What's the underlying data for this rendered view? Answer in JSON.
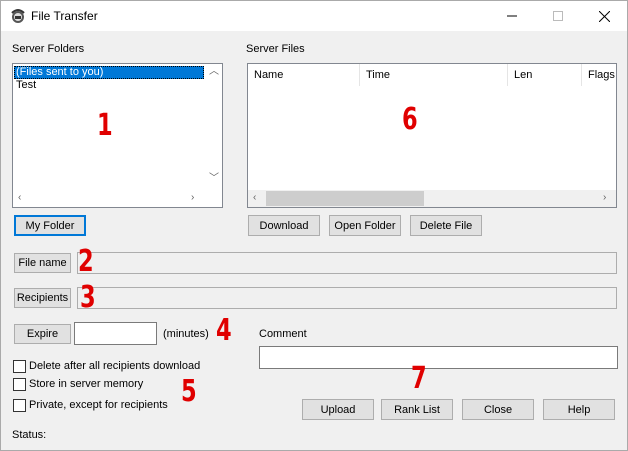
{
  "window": {
    "title": "File Transfer"
  },
  "server_folders": {
    "label": "Server Folders",
    "items": [
      "(Files sent to you)",
      "Test"
    ],
    "selected_index": 0,
    "my_folder_button": "My Folder"
  },
  "server_files": {
    "label": "Server Files",
    "columns": [
      "Name",
      "Time",
      "Len",
      "Flags"
    ],
    "download_button": "Download",
    "open_folder_button": "Open Folder",
    "delete_file_button": "Delete File"
  },
  "file_name": {
    "button": "File name",
    "value": ""
  },
  "recipients": {
    "button": "Recipients",
    "value": ""
  },
  "expire": {
    "button": "Expire",
    "value": "",
    "unit": "(minutes)"
  },
  "comment": {
    "label": "Comment",
    "value": ""
  },
  "options": {
    "delete_after": "Delete after all recipients download",
    "store_memory": "Store in server memory",
    "private": "Private, except for recipients"
  },
  "actions": {
    "upload": "Upload",
    "rank_list": "Rank List",
    "close": "Close",
    "help": "Help"
  },
  "status": {
    "label": "Status:"
  },
  "annotations": [
    "1",
    "2",
    "3",
    "4",
    "5",
    "6",
    "7"
  ],
  "colors": {
    "selection": "#0078d7",
    "annotation": "#e00000"
  }
}
